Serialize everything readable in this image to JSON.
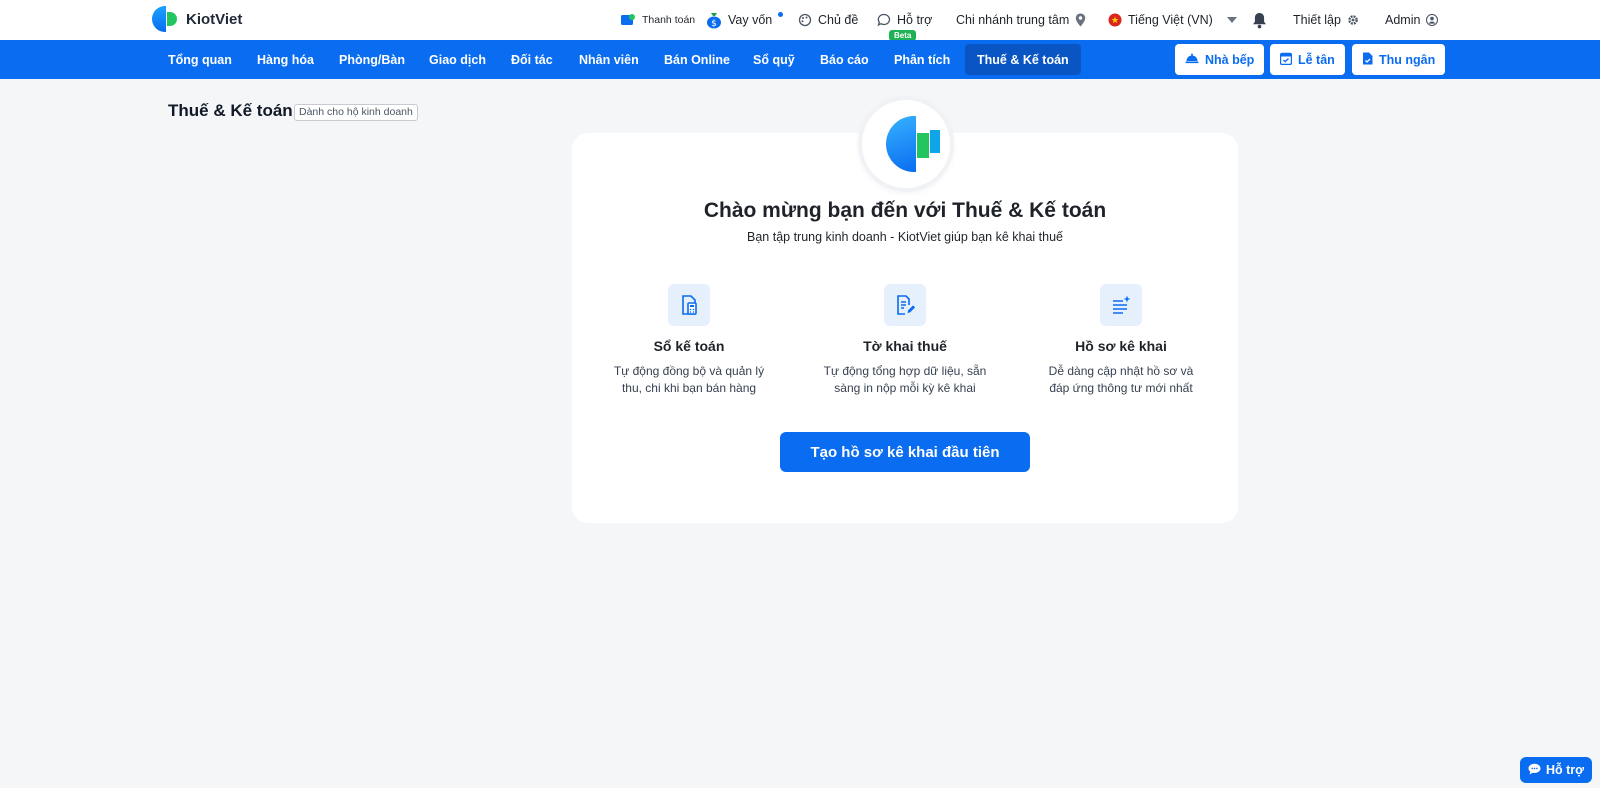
{
  "app": {
    "logo_text": "KiotViet"
  },
  "topbar": {
    "payment_label": "Thanh toán",
    "loan_label": "Vay vốn",
    "theme_label": "Chủ đề",
    "support_label": "Hỗ trợ",
    "beta_label": "Beta",
    "branch_label": "Chi nhánh trung tâm",
    "language_label": "Tiếng Việt (VN)",
    "settings_label": "Thiết lập",
    "user_label": "Admin"
  },
  "nav": {
    "items": [
      "Tổng quan",
      "Hàng hóa",
      "Phòng/Bàn",
      "Giao dịch",
      "Đối tác",
      "Nhân viên",
      "Bán Online",
      "Sổ quỹ",
      "Báo cáo",
      "Phân tích",
      "Thuế & Kế toán"
    ],
    "active_index": 10,
    "kitchen_label": "Nhà bếp",
    "reception_label": "Lễ tân",
    "cashier_label": "Thu ngân"
  },
  "page": {
    "title": "Thuế & Kế toán",
    "tag": "Dành cho hộ kinh doanh"
  },
  "welcome": {
    "title": "Chào mừng bạn đến với Thuế & Kế toán",
    "subtitle": "Bạn tập trung kinh doanh - KiotViet giúp bạn kê khai thuế",
    "features": [
      {
        "icon": "calculator-doc-icon",
        "title": "Sổ kế toán",
        "desc_line1": "Tự động đồng bộ và quản lý",
        "desc_line2": "thu, chi khi bạn bán hàng"
      },
      {
        "icon": "edit-doc-icon",
        "title": "Tờ khai thuế",
        "desc_line1": "Tự động tổng hợp dữ liệu, sẵn",
        "desc_line2": "sàng in nộp mỗi kỳ kê khai"
      },
      {
        "icon": "list-sparkle-icon",
        "title": "Hồ sơ kê khai",
        "desc_line1": "Dễ dàng cập nhật hồ sơ và",
        "desc_line2": "đáp ứng thông tư mới nhất"
      }
    ],
    "cta_label": "Tạo hồ sơ kê khai đầu tiên"
  },
  "help_float": {
    "label": "Hỗ trợ"
  },
  "colors": {
    "primary": "#0a6cf0",
    "nav_active": "#0a55c4",
    "background": "#f5f6f8",
    "beta": "#1fb156"
  }
}
